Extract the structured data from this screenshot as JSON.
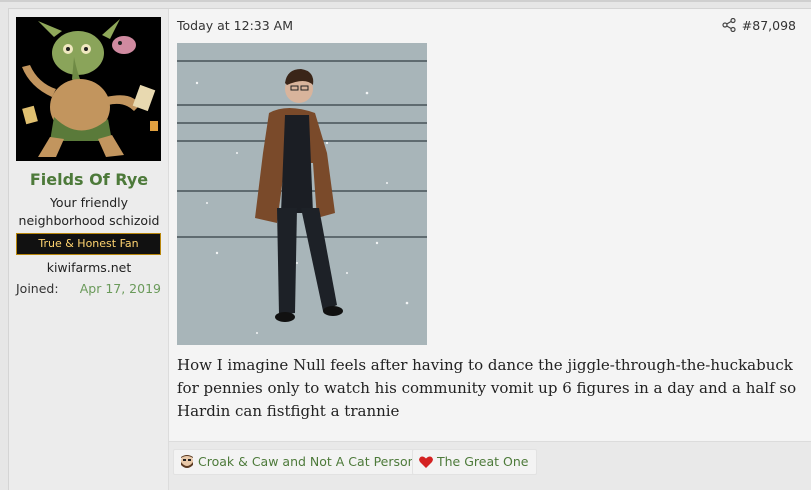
{
  "post": {
    "timestamp": "Today at 12:33 AM",
    "number": "#87,098",
    "text": "How I imagine Null feels after having to dance the jiggle-through-the-huckabuck for pennies only to watch his community vomit up 6 figures in a day and a half so Hardin can fistfight a trannie",
    "share_icon": "share-icon"
  },
  "user": {
    "name": "Fields Of Rye",
    "title": "Your friendly neighborhood schizoid",
    "banner": "True & Honest Fan",
    "extra": "kiwifarms.net",
    "joined_label": "Joined:",
    "joined_value": "Apr 17, 2019",
    "avatar_icon": "goblin-avatar"
  },
  "reactions": [
    {
      "label": "Croak & Caw and Not A Cat Person",
      "icon": "bearded-face-icon"
    },
    {
      "label": "The Great One",
      "icon": "heart-icon"
    }
  ],
  "colors": {
    "username": "#4d7a3a",
    "joined": "#6a9a5a",
    "banner_text": "#ffd470",
    "banner_border": "#b8860b",
    "heart": "#d42222"
  }
}
